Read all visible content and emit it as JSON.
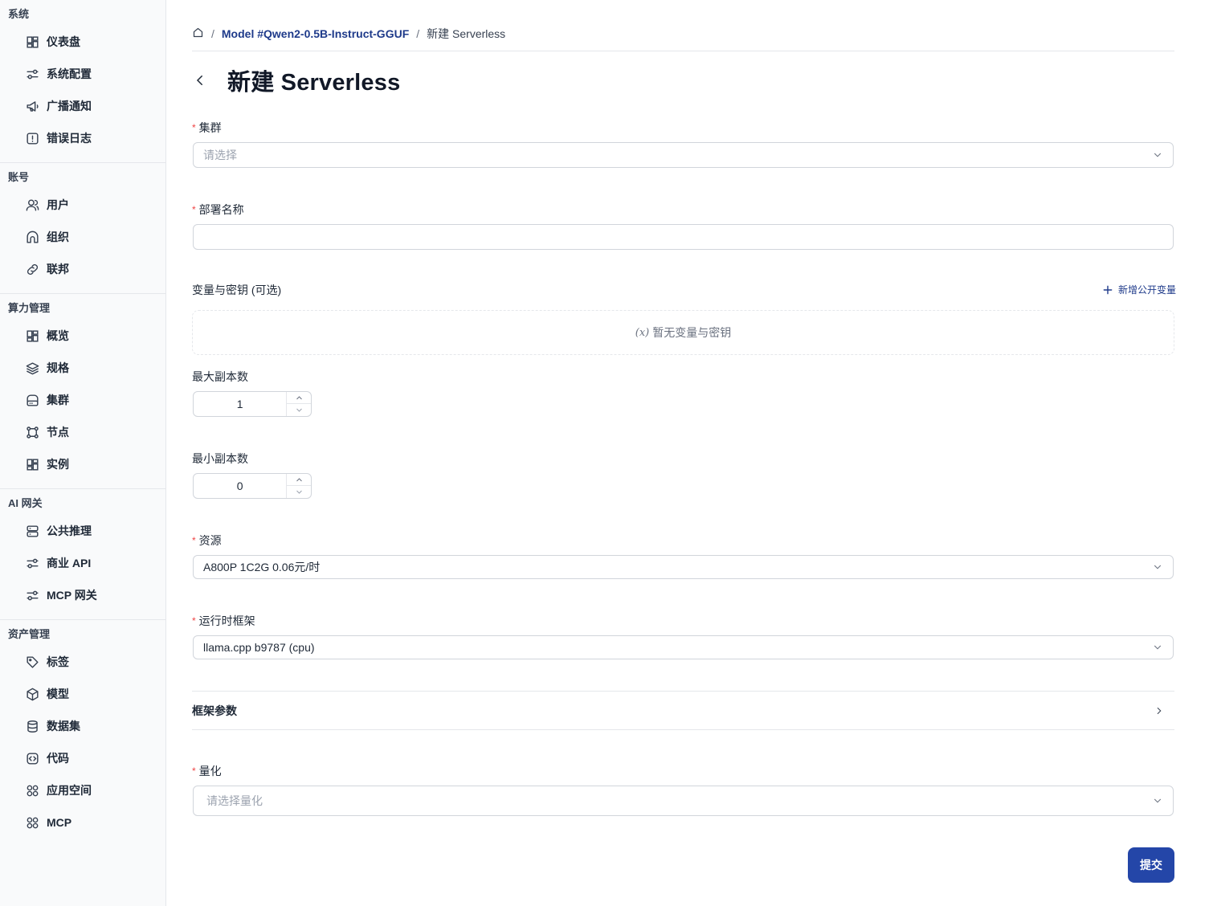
{
  "sidebar": {
    "groups": [
      {
        "title": "系统",
        "items": [
          {
            "label": "仪表盘",
            "icon": "dashboard-icon"
          },
          {
            "label": "系统配置",
            "icon": "sliders-icon"
          },
          {
            "label": "广播通知",
            "icon": "megaphone-icon"
          },
          {
            "label": "错误日志",
            "icon": "alert-square-icon"
          }
        ]
      },
      {
        "title": "账号",
        "items": [
          {
            "label": "用户",
            "icon": "users-icon"
          },
          {
            "label": "组织",
            "icon": "organization-icon"
          },
          {
            "label": "联邦",
            "icon": "link-icon"
          }
        ]
      },
      {
        "title": "算力管理",
        "items": [
          {
            "label": "概览",
            "icon": "dashboard-icon"
          },
          {
            "label": "规格",
            "icon": "layers-icon"
          },
          {
            "label": "集群",
            "icon": "hard-drive-icon"
          },
          {
            "label": "节点",
            "icon": "nodes-icon"
          },
          {
            "label": "实例",
            "icon": "dashboard-icon"
          }
        ]
      },
      {
        "title": "AI 网关",
        "items": [
          {
            "label": "公共推理",
            "icon": "server-icon"
          },
          {
            "label": "商业 API",
            "icon": "sliders-icon"
          },
          {
            "label": "MCP 网关",
            "icon": "sliders-icon"
          }
        ]
      },
      {
        "title": "资产管理",
        "items": [
          {
            "label": "标签",
            "icon": "tag-icon"
          },
          {
            "label": "模型",
            "icon": "cube-icon"
          },
          {
            "label": "数据集",
            "icon": "database-icon"
          },
          {
            "label": "代码",
            "icon": "code-icon"
          },
          {
            "label": "应用空间",
            "icon": "apps-icon"
          },
          {
            "label": "MCP",
            "icon": "apps-icon"
          }
        ]
      }
    ]
  },
  "breadcrumb": {
    "home_icon": "home-icon",
    "model_link": "Model #Qwen2-0.5B-Instruct-GGUF",
    "current": "新建 Serverless"
  },
  "page": {
    "title": "新建 Serverless"
  },
  "form": {
    "cluster": {
      "label": "集群",
      "placeholder": "请选择"
    },
    "deploy_name": {
      "label": "部署名称",
      "value": ""
    },
    "variables": {
      "label": "变量与密钥 (可选)",
      "add_label": "新增公开变量",
      "empty_text": "暂无变量与密钥",
      "empty_icon_text": "(x)"
    },
    "max_replicas": {
      "label": "最大副本数",
      "value": "1"
    },
    "min_replicas": {
      "label": "最小副本数",
      "value": "0"
    },
    "resource": {
      "label": "资源",
      "value": "A800P 1C2G 0.06元/时"
    },
    "runtime": {
      "label": "运行时框架",
      "value": "llama.cpp b9787 (cpu)"
    },
    "framework_params": {
      "label": "框架参数"
    },
    "quantization": {
      "label": "量化",
      "placeholder": "请选择量化"
    },
    "submit_label": "提交"
  },
  "colors": {
    "primary": "#2446a8",
    "link": "#1e3a8a",
    "required": "#ef4444"
  }
}
